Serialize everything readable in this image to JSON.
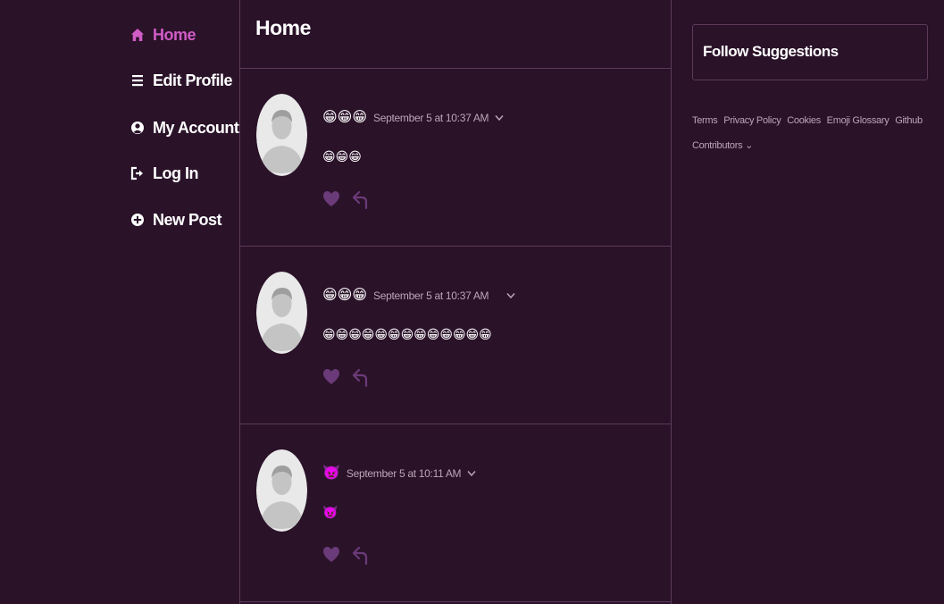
{
  "nav": {
    "items": [
      {
        "label": "Home",
        "icon": "home-icon",
        "active": true
      },
      {
        "label": "Edit Profile",
        "icon": "menu-icon",
        "active": false
      },
      {
        "label": "My Account",
        "icon": "user-icon",
        "active": false
      },
      {
        "label": "Log In",
        "icon": "login-icon",
        "active": false
      },
      {
        "label": "New Post",
        "icon": "plus-circle-icon",
        "active": false
      }
    ]
  },
  "header": {
    "title": "Home"
  },
  "posts": [
    {
      "author_emoji": "😁😁😁",
      "date": "September 5 at 10:37 AM",
      "body": "😁😁😁"
    },
    {
      "author_emoji": "😁😁😁",
      "date": "September 5 at 10:37 AM",
      "body": "😁😁😁😁😁😁😁😁😁😁😁😁😁"
    },
    {
      "author_emoji": "👿",
      "date": "September 5 at 10:11 AM",
      "body": "👿"
    }
  ],
  "sidebar_right": {
    "follow_title": "Follow Suggestions",
    "links": [
      "Terms",
      "Privacy Policy",
      "Cookies",
      "Emoji Glossary",
      "Github"
    ],
    "contributors": "Contributors"
  },
  "colors": {
    "background": "#2a1229",
    "accent": "#d05cc6",
    "border": "#5b3b59",
    "muted_text": "#b9a7b7",
    "heart": "#6b3a78"
  }
}
